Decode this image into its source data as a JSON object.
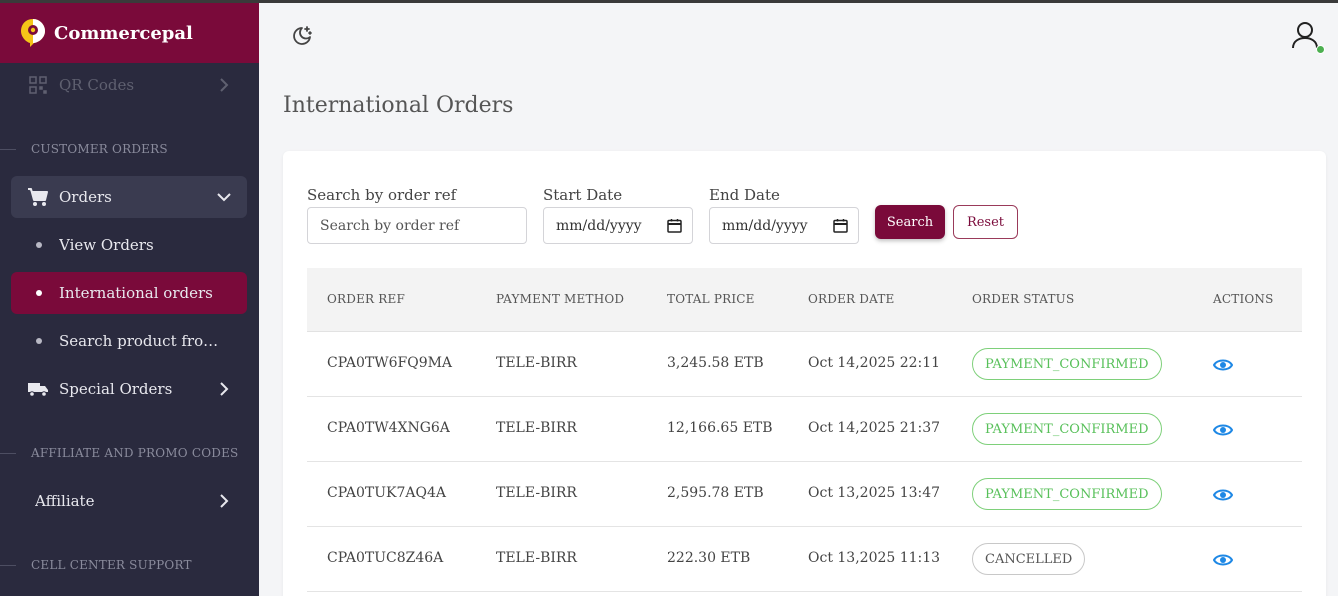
{
  "brand": {
    "name": "Commercepal"
  },
  "sidebar": {
    "qr_codes": "QR Codes",
    "section_customer_orders": "CUSTOMER ORDERS",
    "orders": "Orders",
    "view_orders": "View Orders",
    "international_orders": "International orders",
    "search_product": "Search product from pr...",
    "special_orders": "Special Orders",
    "section_affiliate": "AFFILIATE AND PROMO CODES",
    "affiliate": "Affiliate",
    "section_cell_center": "CELL CENTER SUPPORT"
  },
  "page": {
    "title": "International Orders"
  },
  "filters": {
    "order_ref_label": "Search by order ref",
    "order_ref_placeholder": "Search by order ref",
    "start_date_label": "Start Date",
    "start_date_value": "mm/dd/yyyy",
    "end_date_label": "End Date",
    "end_date_value": "mm/dd/yyyy",
    "search_button": "Search",
    "reset_button": "Reset"
  },
  "table": {
    "headers": {
      "order_ref": "ORDER REF",
      "payment_method": "PAYMENT METHOD",
      "total_price": "TOTAL PRICE",
      "order_date": "ORDER DATE",
      "order_status": "ORDER STATUS",
      "actions": "ACTIONS"
    },
    "rows": [
      {
        "order_ref": "CPA0TW6FQ9MA",
        "payment_method": "TELE-BIRR",
        "total_price": "3,245.58 ETB",
        "order_date": "Oct 14,2025 22:11",
        "order_status": "PAYMENT_CONFIRMED"
      },
      {
        "order_ref": "CPA0TW4XNG6A",
        "payment_method": "TELE-BIRR",
        "total_price": "12,166.65 ETB",
        "order_date": "Oct 14,2025 21:37",
        "order_status": "PAYMENT_CONFIRMED"
      },
      {
        "order_ref": "CPA0TUK7AQ4A",
        "payment_method": "TELE-BIRR",
        "total_price": "2,595.78 ETB",
        "order_date": "Oct 13,2025 13:47",
        "order_status": "PAYMENT_CONFIRMED"
      },
      {
        "order_ref": "CPA0TUC8Z46A",
        "payment_method": "TELE-BIRR",
        "total_price": "222.30 ETB",
        "order_date": "Oct 13,2025 11:13",
        "order_status": "CANCELLED"
      }
    ]
  },
  "colors": {
    "brand": "#7a0a3a",
    "sidebar_bg": "#2a2a3e",
    "status_confirmed": "#58c05a",
    "action_eye": "#1e88e5",
    "online": "#4caf50"
  },
  "icons": {
    "logo": "commercepal-logo-icon",
    "qr": "qr-code-icon",
    "cart": "cart-icon",
    "truck": "truck-icon",
    "theme": "moon-stars-icon",
    "user": "user-icon",
    "eye": "eye-icon",
    "calendar": "calendar-icon"
  }
}
